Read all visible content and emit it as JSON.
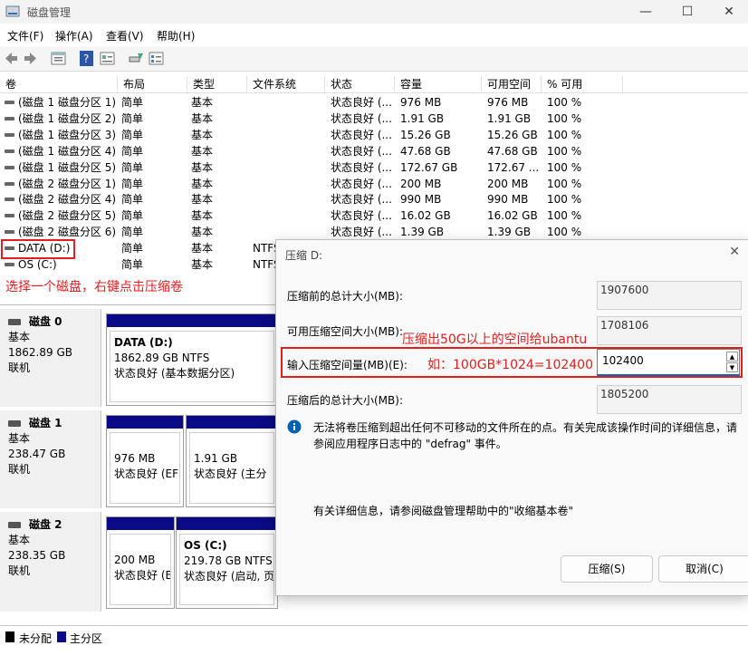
{
  "window": {
    "title": "磁盘管理",
    "minimize": "—",
    "maximize": "☐",
    "close": "✕"
  },
  "menu": [
    "文件(F)",
    "操作(A)",
    "查看(V)",
    "帮助(H)"
  ],
  "table": {
    "headers": [
      "卷",
      "布局",
      "类型",
      "文件系统",
      "状态",
      "容量",
      "可用空间",
      "% 可用"
    ],
    "rows": [
      [
        "(磁盘 1 磁盘分区 1)",
        "简单",
        "基本",
        "",
        "状态良好 (...",
        "976 MB",
        "976 MB",
        "100 %"
      ],
      [
        "(磁盘 1 磁盘分区 2)",
        "简单",
        "基本",
        "",
        "状态良好 (...",
        "1.91 GB",
        "1.91 GB",
        "100 %"
      ],
      [
        "(磁盘 1 磁盘分区 3)",
        "简单",
        "基本",
        "",
        "状态良好 (...",
        "15.26 GB",
        "15.26 GB",
        "100 %"
      ],
      [
        "(磁盘 1 磁盘分区 4)",
        "简单",
        "基本",
        "",
        "状态良好 (...",
        "47.68 GB",
        "47.68 GB",
        "100 %"
      ],
      [
        "(磁盘 1 磁盘分区 5)",
        "简单",
        "基本",
        "",
        "状态良好 (...",
        "172.67 GB",
        "172.67 ...",
        "100 %"
      ],
      [
        "(磁盘 2 磁盘分区 1)",
        "简单",
        "基本",
        "",
        "状态良好 (...",
        "200 MB",
        "200 MB",
        "100 %"
      ],
      [
        "(磁盘 2 磁盘分区 4)",
        "简单",
        "基本",
        "",
        "状态良好 (...",
        "990 MB",
        "990 MB",
        "100 %"
      ],
      [
        "(磁盘 2 磁盘分区 5)",
        "简单",
        "基本",
        "",
        "状态良好 (...",
        "16.02 GB",
        "16.02 GB",
        "100 %"
      ],
      [
        "(磁盘 2 磁盘分区 6)",
        "简单",
        "基本",
        "",
        "状态良好 (...",
        "1.39 GB",
        "1.39 GB",
        "100 %"
      ],
      [
        "DATA (D:)",
        "简单",
        "基本",
        "NTFS",
        "",
        "",
        "",
        ""
      ],
      [
        "OS (C:)",
        "简单",
        "基本",
        "NTFS",
        "",
        "",
        "",
        ""
      ]
    ]
  },
  "annotations": {
    "select_disk": "选择一个磁盘，右键点击压缩卷",
    "shrink_amount": "压缩出50G以上的空间给ubantu",
    "formula": "如：100GB*1024=102400"
  },
  "disks": [
    {
      "name": "磁盘 0",
      "type": "基本",
      "size": "1862.89 GB",
      "status": "联机",
      "partitions": [
        {
          "title": "DATA  (D:)",
          "line1": "1862.89 GB NTFS",
          "line2": "状态良好 (基本数据分区)"
        }
      ]
    },
    {
      "name": "磁盘 1",
      "type": "基本",
      "size": "238.47 GB",
      "status": "联机",
      "partitions": [
        {
          "title": "",
          "line1": "976 MB",
          "line2": "状态良好 (EFI"
        },
        {
          "title": "",
          "line1": "1.91 GB",
          "line2": "状态良好 (主分"
        }
      ]
    },
    {
      "name": "磁盘 2",
      "type": "基本",
      "size": "238.35 GB",
      "status": "联机",
      "partitions": [
        {
          "title": "",
          "line1": "200 MB",
          "line2": "状态良好 (E"
        },
        {
          "title": "OS  (C:)",
          "line1": "219.78 GB NTFS",
          "line2": "状态良好 (启动, 页面"
        }
      ]
    }
  ],
  "legend": {
    "unallocated": "未分配",
    "primary": "主分区",
    "unallocated_color": "#000000",
    "primary_color": "#0a0a87"
  },
  "dialog": {
    "title": "压缩 D:",
    "total_before_label": "压缩前的总计大小(MB):",
    "total_before": "1907600",
    "available_label": "可用压缩空间大小(MB):",
    "available": "1708106",
    "input_label": "输入压缩空间量(MB)(E):",
    "input_value": "102400",
    "total_after_label": "压缩后的总计大小(MB):",
    "total_after": "1805200",
    "info": "无法将卷压缩到超出任何不可移动的文件所在的点。有关完成该操作时间的详细信息，请参阅应用程序日志中的 \"defrag\" 事件。",
    "help": "有关详细信息，请参阅磁盘管理帮助中的\"收缩基本卷\"",
    "shrink_button": "压缩(S)",
    "cancel_button": "取消(C)"
  }
}
